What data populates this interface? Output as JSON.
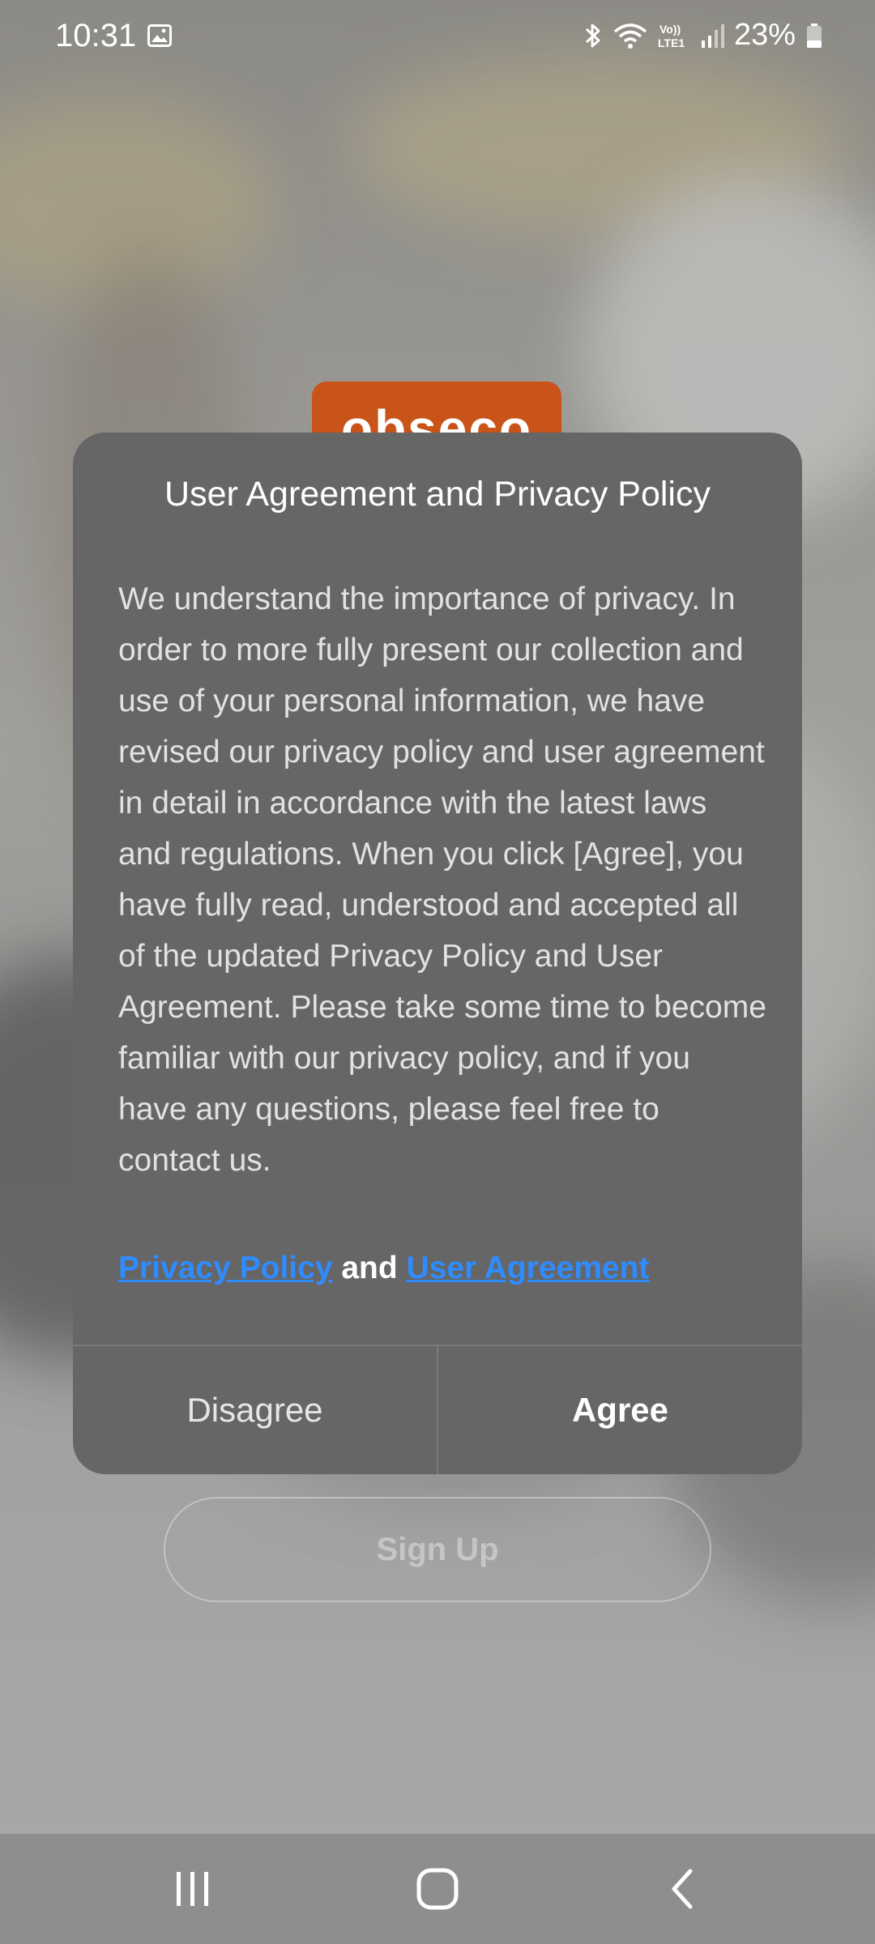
{
  "status_bar": {
    "time": "10:31",
    "battery_percent": "23%",
    "icons": [
      "gallery-icon",
      "bluetooth-icon",
      "wifi-icon",
      "volte-icon",
      "signal-icon",
      "battery-icon"
    ],
    "volte_label": "Vo))",
    "lte_label": "LTE1"
  },
  "logo": {
    "text": "obseco"
  },
  "dialog": {
    "title": "User Agreement and Privacy Policy",
    "body": "We understand the importance of privacy. In order to more fully present our collection and use of your personal information, we have revised our privacy policy and user agreement in detail in accordance with the latest laws and regulations. When you click [Agree], you have fully read, understood and accepted all of the updated Privacy Policy and User Agreement. Please take some time to become familiar with our privacy policy, and if you have any questions, please feel free to contact us.",
    "privacy_link": "Privacy Policy",
    "links_and": "and",
    "agreement_link": "User Agreement",
    "disagree_label": "Disagree",
    "agree_label": "Agree",
    "link_color": "#2f8cff"
  },
  "background": {
    "signup_label": "Sign Up"
  },
  "nav_bar": {
    "icons": [
      "recent-apps-icon",
      "home-icon",
      "back-icon"
    ]
  }
}
